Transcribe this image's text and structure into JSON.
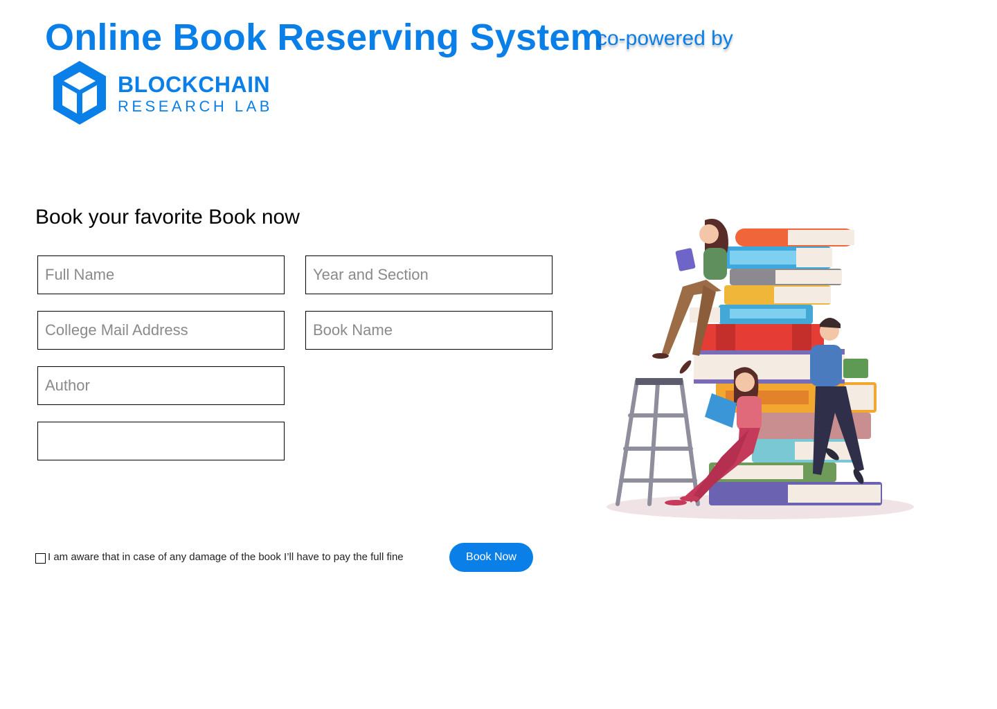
{
  "header": {
    "title": "Online Book Reserving System",
    "co_powered": "co-powered by",
    "logo_line1": "BLOCKCHAIN",
    "logo_line2": "RESEARCH LAB"
  },
  "form": {
    "heading": "Book your favorite Book now",
    "fields": [
      {
        "placeholder": "Full Name",
        "value": ""
      },
      {
        "placeholder": "Year and Section",
        "value": ""
      },
      {
        "placeholder": "College Mail Address",
        "value": ""
      },
      {
        "placeholder": "Book Name",
        "value": ""
      },
      {
        "placeholder": "Author",
        "value": ""
      },
      {
        "placeholder": "",
        "value": ""
      }
    ],
    "consent_text": "I am aware that in case of any damage of the book I’ll have to pay the full fine",
    "submit_label": "Book Now"
  },
  "colors": {
    "accent": "#0b7fe8",
    "border": "#000000",
    "placeholder": "#8a8a8a"
  },
  "icons": {
    "logo": "cube-logo-icon",
    "illustration": "reading-people-books-illustration"
  }
}
